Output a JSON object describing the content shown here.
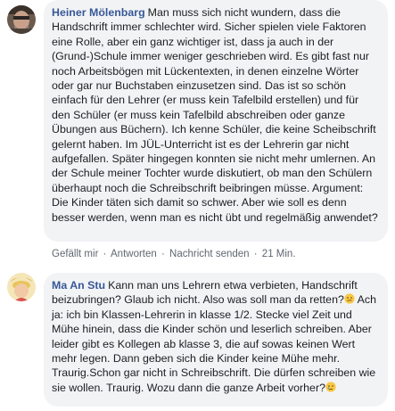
{
  "comments": [
    {
      "author": "Heiner Mölenbarg",
      "text": "Man muss sich nicht wundern, dass die Handschrift immer schlechter wird. Sicher spielen viele Faktoren eine Rolle, aber ein ganz wichtiger ist, dass ja auch in der (Grund-)Schule immer weniger geschrieben wird. Es gibt fast nur noch Arbeitsbögen mit Lückentexten, in denen einzelne Wörter oder gar nur Buchstaben einzusetzen sind. Das ist so schön einfach für den Lehrer (er muss kein Tafelbild erstellen) und für den Schüler (er muss kein Tafelbild abschreiben oder ganze Übungen aus Büchern). Ich kenne Schüler, die keine Scheibschrift gelernt haben. Im JÜL-Unterricht ist es der Lehrerin gar nicht aufgefallen. Später hingegen konnten sie nicht mehr umlernen. An der Schule meiner Tochter wurde diskutiert, ob man den Schülern überhaupt noch die Schreibschrift beibringen müsse. Argument: Die Kinder täten sich damit so schwer. Aber wie soll es denn besser werden, wenn man es nicht übt und regelmäßig anwendet?",
      "actions": {
        "like": "Gefällt mir",
        "reply": "Antworten",
        "message": "Nachricht senden",
        "time": "21 Min."
      }
    },
    {
      "author": "Ma An Stu",
      "text_1": "Kann man uns Lehrern etwa verbieten, Handschrift beizubringen? Glaub ich nicht. Also was soll man da retten?",
      "text_2": " Ach ja: ich bin Klassen-Lehrerin in klasse 1/2. Stecke viel Zeit und Mühe hinein, dass die Kinder schön und leserlich schreiben. Aber leider gibt es Kollegen ab klasse 3, die auf sowas keinen Wert mehr legen. Dann geben sich die Kinder keine Mühe mehr. Traurig.Schon gar nicht in Schreibschrift. Die dürfen schreiben wie sie wollen. Traurig. Wozu dann die ganze Arbeit vorher?",
      "emoji_1": "confused-face-emoji",
      "emoji_2": "crying-face-emoji"
    }
  ],
  "separator": "·"
}
